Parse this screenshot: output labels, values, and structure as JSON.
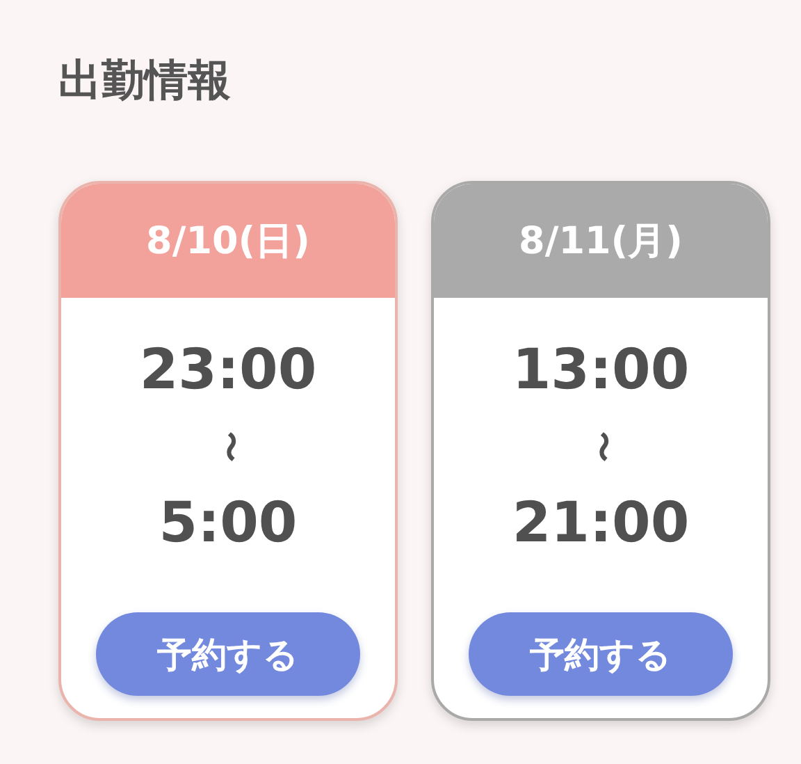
{
  "title": "出勤情報",
  "shifts": [
    {
      "date": "8/10(日)",
      "highlighted": true,
      "start": "23:00",
      "separator": "〜",
      "end": "5:00",
      "button": "予約する"
    },
    {
      "date": "8/11(月)",
      "highlighted": false,
      "start": "13:00",
      "separator": "〜",
      "end": "21:00",
      "button": "予約する"
    }
  ]
}
